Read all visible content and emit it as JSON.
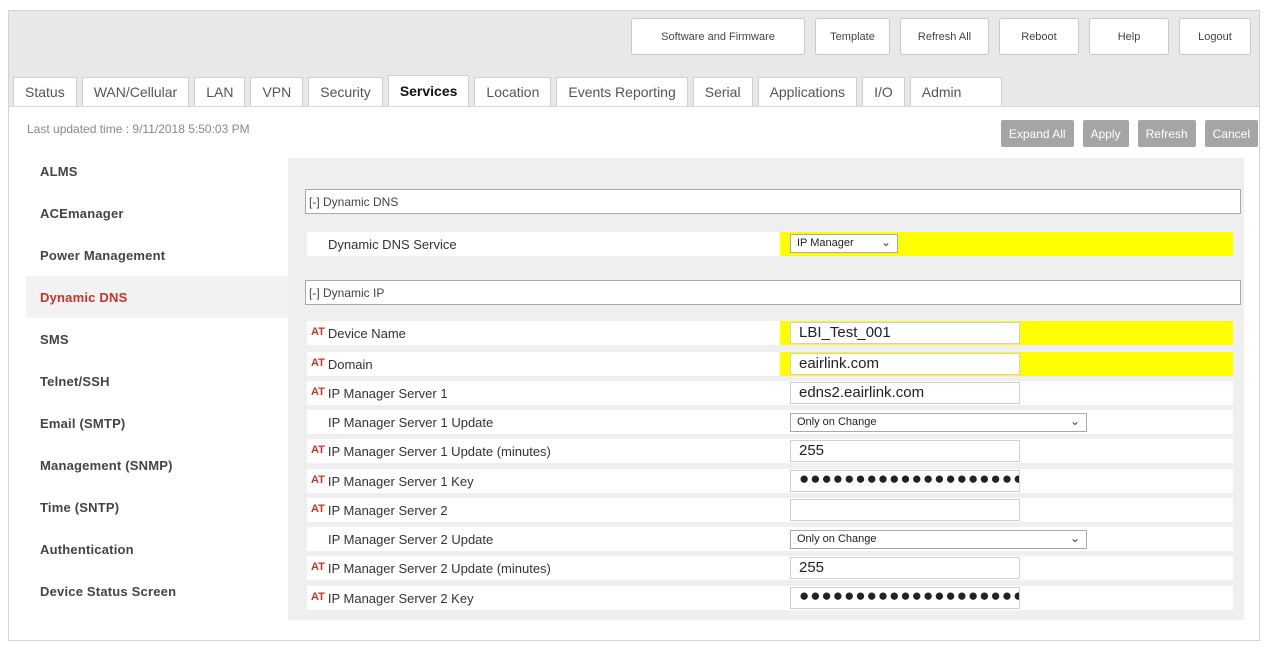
{
  "top_buttons": [
    "Software and Firmware",
    "Template",
    "Refresh All",
    "Reboot",
    "Help",
    "Logout"
  ],
  "tabs": [
    "Status",
    "WAN/Cellular",
    "LAN",
    "VPN",
    "Security",
    "Services",
    "Location",
    "Events Reporting",
    "Serial",
    "Applications",
    "I/O",
    "Admin"
  ],
  "active_tab": "Services",
  "last_updated": "Last updated time : 9/11/2018 5:50:03 PM",
  "action_buttons": [
    "Expand All",
    "Apply",
    "Refresh",
    "Cancel"
  ],
  "sidebar": [
    "ALMS",
    "ACEmanager",
    "Power Management",
    "Dynamic DNS",
    "SMS",
    "Telnet/SSH",
    "Email (SMTP)",
    "Management (SNMP)",
    "Time (SNTP)",
    "Authentication",
    "Device Status Screen"
  ],
  "active_sidebar": "Dynamic DNS",
  "section_dns": "[-] Dynamic DNS",
  "section_ip": "[-] Dynamic IP",
  "dns_service": {
    "label": "Dynamic DNS Service",
    "value": "IP Manager"
  },
  "at_marker": "AT",
  "fields": {
    "device_name": {
      "label": "Device Name",
      "value": "LBI_Test_001"
    },
    "domain": {
      "label": "Domain",
      "value": "eairlink.com"
    },
    "server1": {
      "label": "IP Manager Server 1",
      "value": "edns2.eairlink.com"
    },
    "server1_update": {
      "label": "IP Manager Server 1 Update",
      "value": "Only on Change"
    },
    "server1_update_min": {
      "label": "IP Manager Server 1 Update (minutes)",
      "value": "255"
    },
    "server1_key": {
      "label": "IP Manager Server 1 Key",
      "value": "●●●●●●●●●●●●●●●●●●●●●"
    },
    "server2": {
      "label": "IP Manager Server 2",
      "value": ""
    },
    "server2_update": {
      "label": "IP Manager Server 2 Update",
      "value": "Only on Change"
    },
    "server2_update_min": {
      "label": "IP Manager Server 2 Update (minutes)",
      "value": "255"
    },
    "server2_key": {
      "label": "IP Manager Server 2 Key",
      "value": "●●●●●●●●●●●●●●●●●●●●●"
    }
  },
  "colors": {
    "highlight": "#ffff00",
    "active_red": "#c8322c",
    "action_gray": "#a5a5a5"
  },
  "icons": {
    "dropdown": "chevron-down-icon"
  }
}
